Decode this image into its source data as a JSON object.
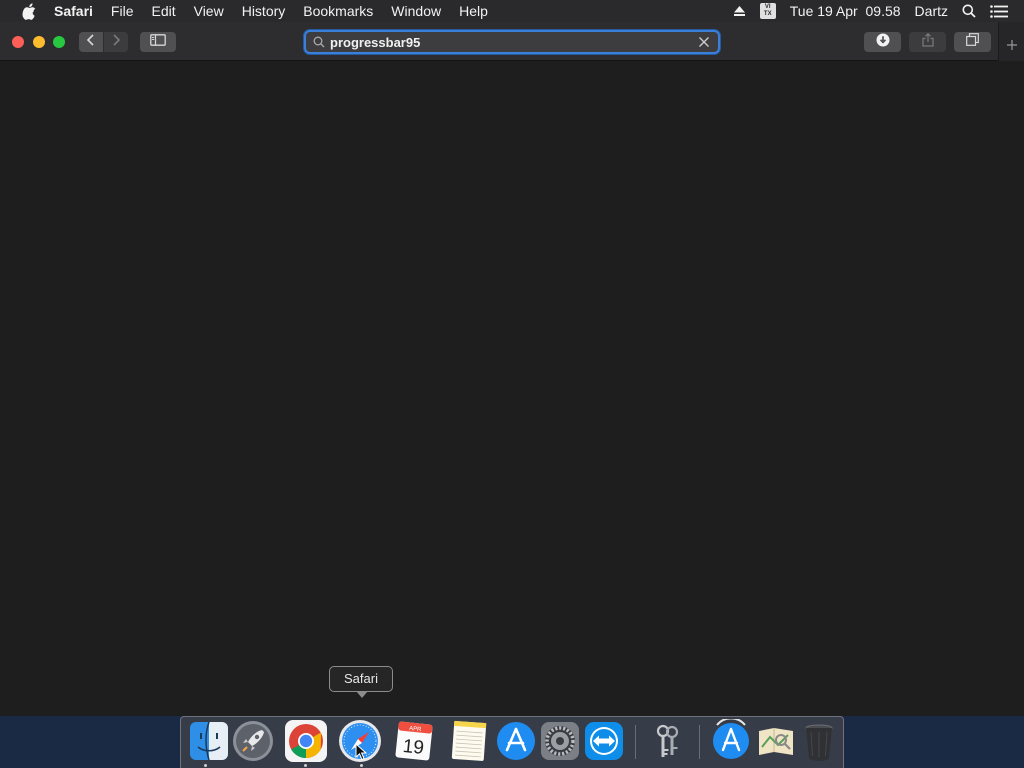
{
  "menubar": {
    "apple_icon": "apple-logo-icon",
    "app_name": "Safari",
    "items": [
      "File",
      "Edit",
      "View",
      "History",
      "Bookmarks",
      "Window",
      "Help"
    ],
    "status": {
      "eject_icon": "eject-icon",
      "input_source_top": "VI",
      "input_source_bottom": "TX",
      "datetime": "Tue 19 Apr  09.58",
      "user": "Dartz",
      "spotlight_icon": "spotlight-search-icon",
      "notification_icon": "notification-center-icon"
    }
  },
  "toolbar": {
    "address_value": "progressbar95",
    "icons": {
      "back": "chevron-left-icon",
      "forward": "chevron-right-icon",
      "sidebar": "sidebar-icon",
      "download": "download-icon",
      "share": "share-icon",
      "tabs": "tab-overview-icon",
      "new_tab": "plus-icon",
      "search": "search-icon",
      "clear": "close-icon"
    }
  },
  "tooltip": {
    "label": "Safari"
  },
  "dock": {
    "apps": [
      {
        "name": "Finder",
        "icon": "finder-icon",
        "running": true
      },
      {
        "name": "Launchpad",
        "icon": "launchpad-rocket-icon",
        "running": false
      },
      {
        "name": "Google Chrome",
        "icon": "chrome-icon",
        "running": true
      },
      {
        "name": "Safari",
        "icon": "safari-compass-icon",
        "running": true
      },
      {
        "name": "Calendar",
        "icon": "calendar-icon",
        "running": false,
        "month": "APR",
        "day": "19"
      },
      {
        "name": "Notes",
        "icon": "notes-icon",
        "running": false
      },
      {
        "name": "App Store",
        "icon": "app-store-icon",
        "running": false
      },
      {
        "name": "System Preferences",
        "icon": "gear-icon",
        "running": false
      },
      {
        "name": "TeamViewer",
        "icon": "teamviewer-icon",
        "running": false
      },
      {
        "name": "Keychain Access",
        "icon": "keychain-icon",
        "running": false
      },
      {
        "name": "App Store Downloads",
        "icon": "app-store-downloads-icon",
        "running": false
      },
      {
        "name": "Directory Utility",
        "icon": "directory-utility-icon",
        "running": false
      },
      {
        "name": "Trash",
        "icon": "trash-icon",
        "running": false
      }
    ]
  },
  "colors": {
    "menubar_bg": "#2a2a2c",
    "toolbar_bg": "#2d2d2f",
    "content_bg": "#1e1e1e",
    "accent_focus": "#3a7fd8",
    "traffic_close": "#fc5f57",
    "traffic_min": "#fdbc2e",
    "traffic_max": "#28c840"
  }
}
